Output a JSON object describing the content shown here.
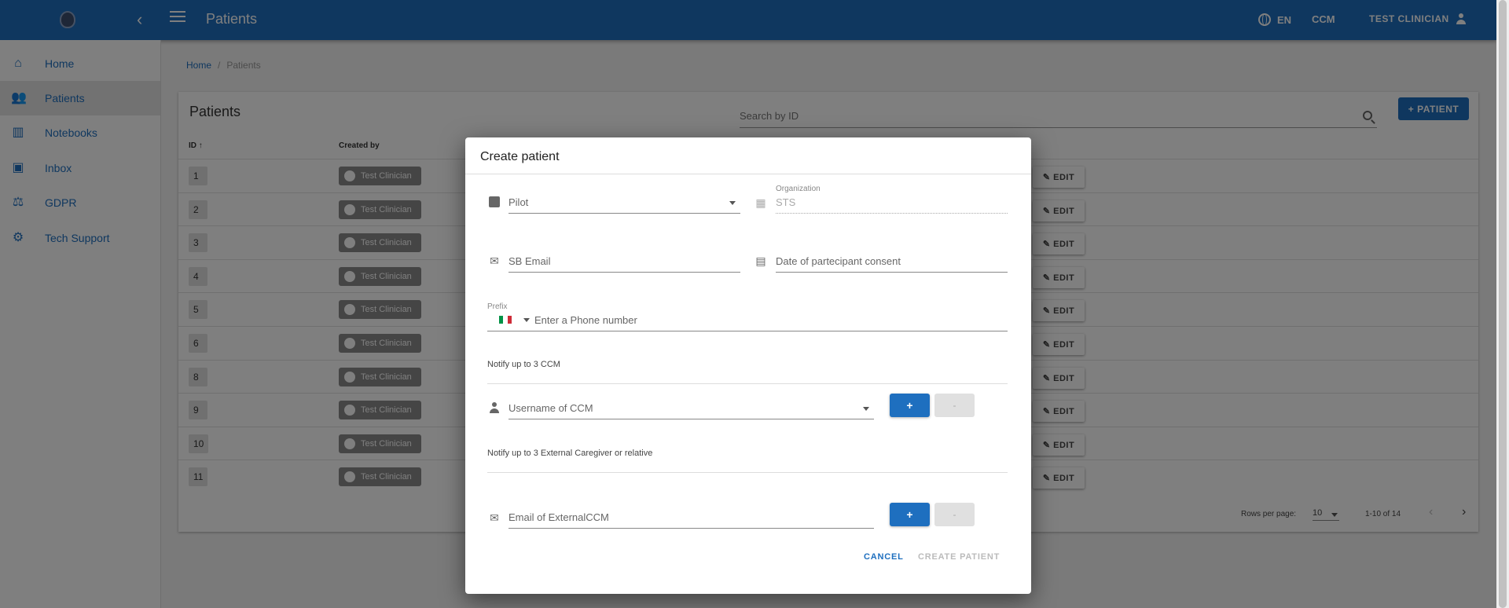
{
  "appbar": {
    "title": "Patients",
    "language": "EN",
    "role": "CCM",
    "user": "TEST CLINICIAN",
    "color": "#1e6fbf"
  },
  "sidebar": {
    "items": [
      {
        "label": "Home",
        "icon": "home-icon"
      },
      {
        "label": "Patients",
        "icon": "people-icon"
      },
      {
        "label": "Notebooks",
        "icon": "chart-icon"
      },
      {
        "label": "Inbox",
        "icon": "inbox-icon"
      },
      {
        "label": "GDPR",
        "icon": "gavel-icon"
      },
      {
        "label": "Tech Support",
        "icon": "support-icon"
      }
    ]
  },
  "breadcrumb": {
    "home": "Home",
    "current": "Patients"
  },
  "table": {
    "title": "Patients",
    "search_placeholder": "Search by ID",
    "add_label": "+ PATIENT",
    "headers": {
      "id": "ID",
      "created_by": "Created by"
    },
    "edit_label": "EDIT",
    "rows": [
      {
        "id": "1",
        "created_by": "Test Clinician"
      },
      {
        "id": "2",
        "created_by": "Test Clinician"
      },
      {
        "id": "3",
        "created_by": "Test Clinician"
      },
      {
        "id": "4",
        "created_by": "Test Clinician"
      },
      {
        "id": "5",
        "created_by": "Test Clinician"
      },
      {
        "id": "6",
        "created_by": "Test Clinician"
      },
      {
        "id": "8",
        "created_by": "Test Clinician"
      },
      {
        "id": "9",
        "created_by": "Test Clinician"
      },
      {
        "id": "10",
        "created_by": "Test Clinician"
      },
      {
        "id": "11",
        "created_by": "Test Clinician"
      }
    ],
    "rows_per_page_label": "Rows per page:",
    "rows_per_page": "10",
    "range": "1-10 of 14"
  },
  "dialog": {
    "title": "Create patient",
    "pilot_placeholder": "Pilot",
    "organization_label": "Organization",
    "organization_value": "STS",
    "sb_email_placeholder": "SB Email",
    "consent_date_placeholder": "Date of partecipant consent",
    "prefix_label": "Prefix",
    "phone_placeholder": "Enter a Phone number",
    "notify_ccm_label": "Notify up to 3 CCM",
    "ccm_username_placeholder": "Username of CCM",
    "notify_external_label": "Notify up to 3 External Caregiver or relative",
    "external_email_placeholder": "Email of ExternalCCM",
    "plus_label": "+",
    "minus_label": "-",
    "cancel_label": "CANCEL",
    "create_label": "CREATE PATIENT",
    "flag_colors": [
      "#009246",
      "#ffffff",
      "#ce2b37"
    ]
  }
}
